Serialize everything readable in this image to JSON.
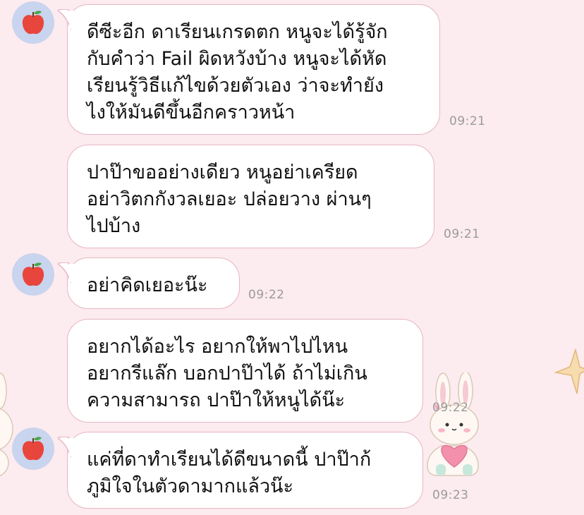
{
  "chat": {
    "messages": [
      {
        "sender_avatar": "apple-icon",
        "lines": [
          "ดีซีะอีก ดาเรียนเกรดตก หนูจะได้รู้จัก",
          "กับคำว่า Fail ผิดหวังบ้าง หนูจะได้หัด",
          "เรียนรู้วิธีแก้ไขด้วยตัวเอง ว่าจะทำยัง",
          "ไงให้มันดีขึ้นอีกคราวหน้า"
        ],
        "time": "09:21"
      },
      {
        "lines": [
          "ปาป๊าขออย่างเดียว หนูอย่าเครียด",
          "อย่าวิตกกังวลเยอะ ปล่อยวาง ผ่านๆ",
          "ไปบ้าง"
        ],
        "time": "09:21"
      },
      {
        "sender_avatar": "apple-icon",
        "lines": [
          "อย่าคิดเยอะน๊ะ"
        ],
        "time": "09:22"
      },
      {
        "lines": [
          "อยากได้อะไร อยากให้พาไปไหน",
          "อยากรีแล๊ก บอกปาป๊าได้ ถ้าไม่เกิน",
          "ความสามารถ ปาป๊าให้หนูได้น๊ะ"
        ],
        "time": "09:22"
      },
      {
        "sender_avatar": "apple-icon",
        "lines": [
          "แค่ที่ดาทำเรียนได้ดีขนาดนี้ ปาป๊าก้",
          "ภูมิใจในตัวดามากแล้วน๊ะ"
        ],
        "time": "09:23"
      }
    ]
  },
  "colors": {
    "background": "#fcebef",
    "bubble": "#ffffff",
    "bubble_border": "#e7b6c2",
    "avatar_bg": "#c9d4ee",
    "apple": "#e8453c",
    "timestamp": "#9a9a9a"
  },
  "decorations": [
    "bunny-sticker-icon",
    "star-icon"
  ]
}
